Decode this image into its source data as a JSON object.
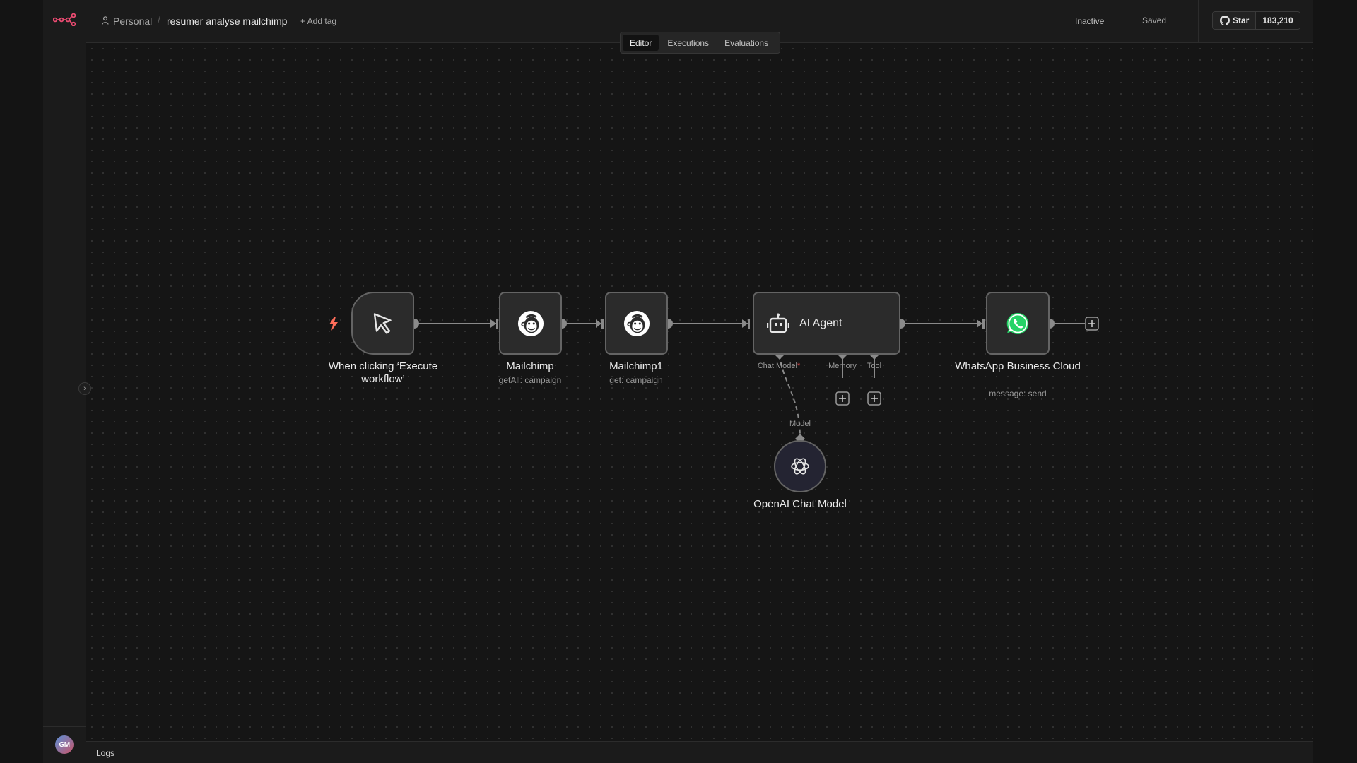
{
  "header": {
    "project": "Personal",
    "workflow_name": "resumer analyse mailchimp",
    "add_tag": "+ Add tag",
    "status": "Inactive",
    "saved": "Saved",
    "github": {
      "star_label": "Star",
      "star_count": "183,210"
    }
  },
  "tabs": [
    {
      "label": "Editor",
      "active": true
    },
    {
      "label": "Executions",
      "active": false
    },
    {
      "label": "Evaluations",
      "active": false
    }
  ],
  "user": {
    "initials": "GM"
  },
  "nodes": {
    "trigger": {
      "title": "When clicking ‘Execute workflow’",
      "icon": "cursor-icon"
    },
    "mailchimp": {
      "title": "Mailchimp",
      "subtitle": "getAll: campaign",
      "icon": "mailchimp-icon"
    },
    "mailchimp1": {
      "title": "Mailchimp1",
      "subtitle": "get: campaign",
      "icon": "mailchimp-icon"
    },
    "agent": {
      "title": "AI Agent",
      "icon": "robot-icon",
      "ports": {
        "chat_model": "Chat Model",
        "required_mark": "*",
        "memory": "Memory",
        "tool": "Tool"
      }
    },
    "whatsapp": {
      "title": "WhatsApp Business Cloud",
      "subtitle": "message: send",
      "icon": "whatsapp-icon"
    },
    "openai": {
      "title": "OpenAI Chat Model",
      "port_label": "Model",
      "icon": "openai-icon"
    }
  },
  "logs": {
    "label": "Logs"
  },
  "colors": {
    "brand": "#ea4b71",
    "trigger": "#ff6d5a",
    "whatsapp": "#25d366",
    "required": "#e5484d"
  }
}
